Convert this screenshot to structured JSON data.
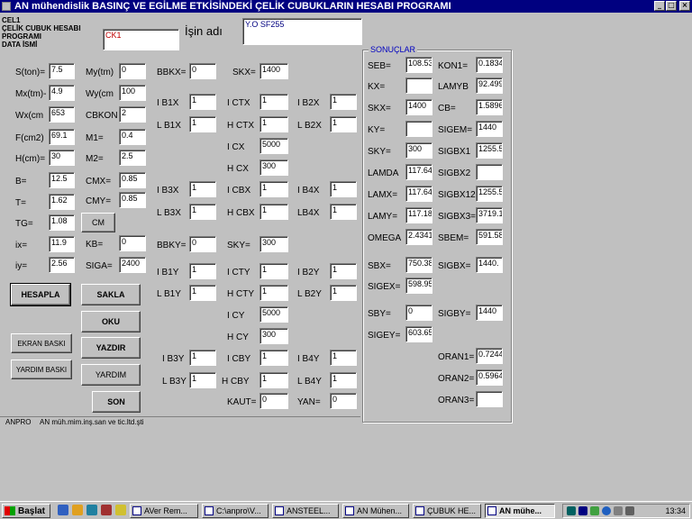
{
  "window": {
    "title": "AN mühendislik BASINÇ VE EGİLME  ETKİSİNDEKİ  ÇELİK  CUBUKLARIN HESABI  PROGRAMI",
    "minimize": "_",
    "maximize": "□",
    "close": "×"
  },
  "header": {
    "program_label_lines": [
      "CEL1",
      "ÇELİK CUBUK  HESABI",
      "PROGRAMI",
      "DATA  İSMİ"
    ],
    "data_name_value": "CK1",
    "work_label": "İşin adı",
    "work_value": "Y.O SF255"
  },
  "col1": [
    {
      "label": "S(ton)=",
      "value": "7.5"
    },
    {
      "label": "Mx(tm)-",
      "value": "4.9"
    },
    {
      "label": "Wx(cm",
      "value": "653"
    },
    {
      "label": "F(cm2)",
      "value": "69.1"
    },
    {
      "label": "H(cm)=",
      "value": "30"
    },
    {
      "label": "B=",
      "value": "12.5"
    },
    {
      "label": "T=",
      "value": "1.62"
    },
    {
      "label": "TG=",
      "value": "1.08"
    },
    {
      "label": "ix=",
      "value": "11.9"
    },
    {
      "label": "iy=",
      "value": "2.56"
    }
  ],
  "col2": [
    {
      "label": "My(tm)",
      "value": "0"
    },
    {
      "label": "Wy(cm",
      "value": "100"
    },
    {
      "label": "CBKON",
      "value": "2"
    },
    {
      "label": "M1=",
      "value": "0.4"
    },
    {
      "label": "M2=",
      "value": "2.5"
    },
    {
      "label": "CMX=",
      "value": "0.85"
    },
    {
      "label": "CMY=",
      "value": "0.85"
    }
  ],
  "col2b": [
    {
      "label": "KB=",
      "value": "0"
    },
    {
      "label": "SIGA=",
      "value": "2400"
    }
  ],
  "cm_button": "CM",
  "buttons": {
    "hesapla": "HESAPLA",
    "sakla": "SAKLA",
    "oku": "OKU",
    "ekran_baski": "EKRAN BASKI",
    "yazdir": "YAZDIR",
    "yardim_baski": "YARDIM BASKI",
    "yardim": "YARDIM",
    "son": "SON"
  },
  "col3": {
    "bbkx": {
      "label": "BBKX=",
      "value": "0"
    },
    "b1x": {
      "label": "I B1X",
      "value": "1"
    },
    "lb1x": {
      "label": "L B1X",
      "value": "1"
    },
    "b3x": {
      "label": "I B3X",
      "value": "1"
    },
    "lb3x": {
      "label": "L B3X",
      "value": "1"
    },
    "bbky": {
      "label": "BBKY=",
      "value": "0"
    },
    "b1y": {
      "label": "I B1Y",
      "value": "1"
    },
    "lb1y": {
      "label": "L B1Y",
      "value": "1"
    },
    "b3y": {
      "label": "I B3Y",
      "value": "1"
    },
    "lb3y": {
      "label": "L B3Y",
      "value": "1"
    }
  },
  "col4": {
    "skx": {
      "label": "SKX=",
      "value": "1400"
    },
    "ictx": {
      "label": "I CTX",
      "value": "1"
    },
    "hctx": {
      "label": "H CTX",
      "value": "1"
    },
    "icx": {
      "label": "I CX",
      "value": "5000"
    },
    "hcx": {
      "label": "H CX",
      "value": "300"
    },
    "icbx": {
      "label": "I CBX",
      "value": "1"
    },
    "hcbx": {
      "label": "H CBX",
      "value": "1"
    },
    "sky": {
      "label": "SKY=",
      "value": "300"
    },
    "icty": {
      "label": "I CTY",
      "value": "1"
    },
    "hcty": {
      "label": "H CTY",
      "value": "1"
    },
    "icy": {
      "label": "I CY",
      "value": "5000"
    },
    "hcy": {
      "label": "H CY",
      "value": "300"
    },
    "icby": {
      "label": "I CBY",
      "value": "1"
    },
    "hcby": {
      "label": "H CBY",
      "value": "1"
    },
    "kaut": {
      "label": "KAUT=",
      "value": "0"
    }
  },
  "col5": {
    "b2x": {
      "label": "I B2X",
      "value": "1"
    },
    "lb2x": {
      "label": "L B2X",
      "value": "1"
    },
    "b4x": {
      "label": "I B4X",
      "value": "1"
    },
    "lb4x": {
      "label": "LB4X",
      "value": "1"
    },
    "b2y": {
      "label": "I B2Y",
      "value": "1"
    },
    "lb2y": {
      "label": "L B2Y",
      "value": "1"
    },
    "b4y": {
      "label": "I B4Y",
      "value": "1"
    },
    "lb4y": {
      "label": "L B4Y",
      "value": "1"
    },
    "yan": {
      "label": "YAN=",
      "value": "0"
    }
  },
  "results": {
    "title": "SONUÇLAR",
    "left": [
      {
        "label": "SEB=",
        "value": "108.53"
      },
      {
        "label": "KX=",
        "value": ""
      },
      {
        "label": "SKX=",
        "value": "1400"
      },
      {
        "label": "KY=",
        "value": ""
      },
      {
        "label": "SKY=",
        "value": "300"
      },
      {
        "label": "LAMDA",
        "value": "117.64"
      },
      {
        "label": "LAMX=",
        "value": "117.64"
      },
      {
        "label": "LAMY=",
        "value": "117.18"
      },
      {
        "label": "OMEGA",
        "value": "2.4341"
      },
      {
        "label": "SBX=",
        "value": "750.38"
      },
      {
        "label": "SIGEX=",
        "value": "598.95"
      },
      {
        "label": "SBY=",
        "value": "0"
      },
      {
        "label": "SIGEY=",
        "value": "603.65"
      }
    ],
    "right": [
      {
        "label": "KON1=",
        "value": "0.1834"
      },
      {
        "label": "LAMYB",
        "value": "92.499"
      },
      {
        "label": "CB=",
        "value": "1.5896"
      },
      {
        "label": "SIGEM=",
        "value": "1440"
      },
      {
        "label": "SIGBX1",
        "value": "1255.5"
      },
      {
        "label": "SIGBX2",
        "value": ""
      },
      {
        "label": "SIGBX12",
        "value": "1255.5"
      },
      {
        "label": "SIGBX3=",
        "value": "3719.1"
      },
      {
        "label": "SBEM=",
        "value": "591.58"
      },
      {
        "label": "SIGBX=",
        "value": "1440."
      },
      {
        "label": "SIGBY=",
        "value": "1440"
      },
      {
        "label": "ORAN1=",
        "value": "0.7244"
      },
      {
        "label": "ORAN2=",
        "value": "0.5964"
      },
      {
        "label": "ORAN3=",
        "value": ""
      }
    ]
  },
  "status_bar": {
    "left": "ANPRO",
    "right": "AN müh.mim.inş.san ve tic.ltd.şti"
  },
  "taskbar": {
    "start": "Başlat",
    "tasks": [
      "AVer Rem...",
      "C:\\anpro\\V...",
      "ANSTEEL...",
      "AN Mühen...",
      "ÇUBUK HE...",
      "AN mühe..."
    ],
    "clock": "13:34"
  }
}
